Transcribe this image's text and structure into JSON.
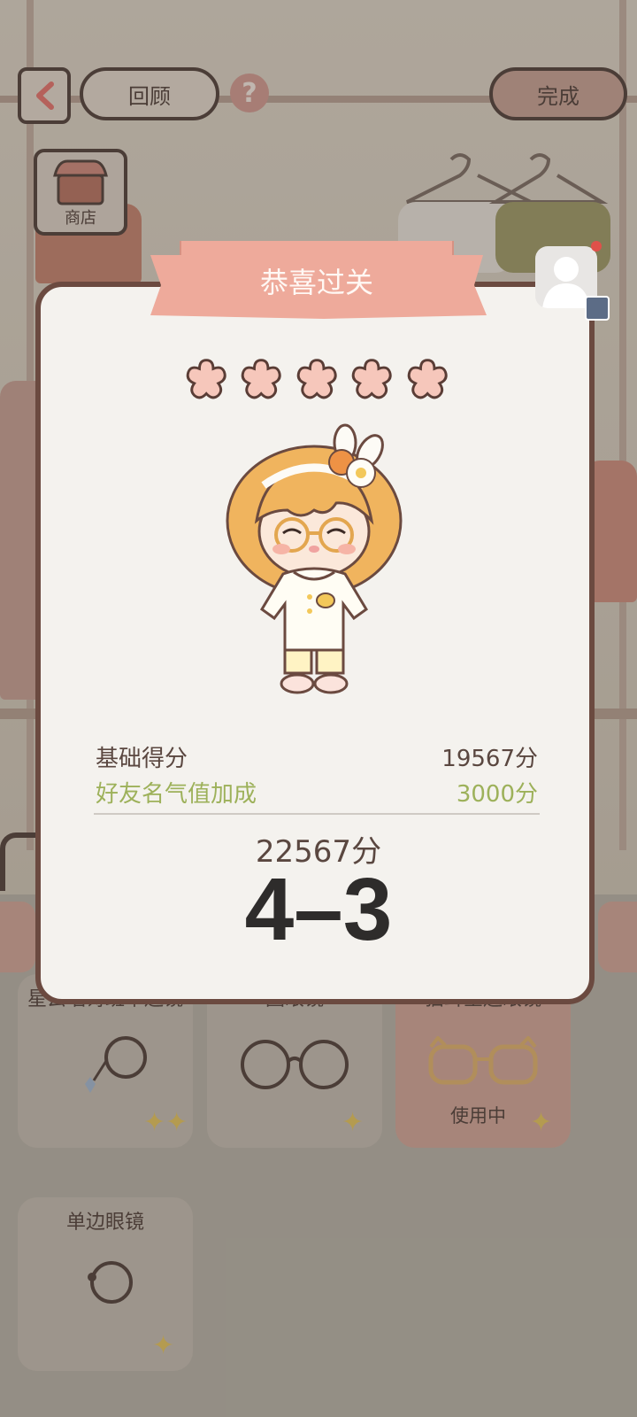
{
  "header": {
    "back_icon": "chevron-left-icon",
    "review_label": "回顾",
    "help_label": "?",
    "done_label": "完成",
    "shop_label": "商店"
  },
  "modal": {
    "title": "恭喜过关",
    "stars_filled": 5,
    "stars_total": 5,
    "base_score_label": "基础得分",
    "base_score_value": "19567分",
    "bonus_label": "好友名气值加成",
    "bonus_value": "3000分",
    "total_score": "22567分",
    "level": "4–3"
  },
  "items": [
    {
      "name": "星云唱诗班单边镜",
      "status": ""
    },
    {
      "name": "圆眼镜",
      "status": ""
    },
    {
      "name": "猫耳金边眼镜",
      "status": "使用中"
    },
    {
      "name": "单边眼镜",
      "status": ""
    }
  ],
  "colors": {
    "banner": "#eeaa9b",
    "bonus_text": "#9db15a",
    "star_fill": "#f6c7bb",
    "notification_dot": "#e0504a",
    "active_card": "#c49688"
  }
}
